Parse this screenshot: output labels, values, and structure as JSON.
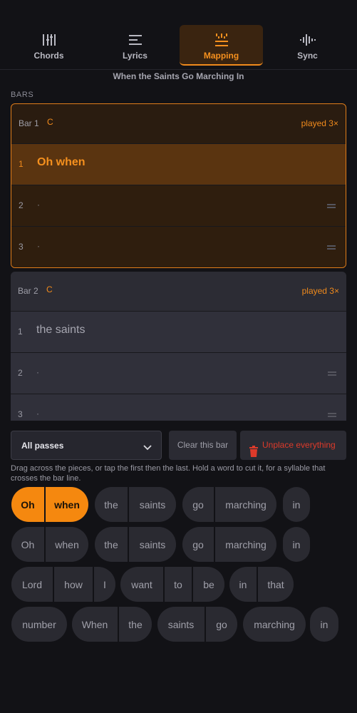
{
  "tabs": [
    {
      "label": "Chords",
      "icon": "chords-icon",
      "active": false
    },
    {
      "label": "Lyrics",
      "icon": "lyrics-icon",
      "active": false
    },
    {
      "label": "Mapping",
      "icon": "mapping-icon",
      "active": true
    },
    {
      "label": "Sync",
      "icon": "sync-icon",
      "active": false
    }
  ],
  "song_title": "When the Saints Go Marching In",
  "bars_label": "BARS",
  "bars": [
    {
      "name": "Bar 1",
      "chord": "C",
      "played": "played 3×",
      "rows": [
        {
          "num": "1",
          "text": "Oh when",
          "highlighted": true
        },
        {
          "num": "2",
          "text": "·",
          "highlighted": false
        },
        {
          "num": "3",
          "text": "·",
          "highlighted": false
        }
      ]
    },
    {
      "name": "Bar 2",
      "chord": "C",
      "played": "played 3×",
      "rows": [
        {
          "num": "1",
          "text": "the saints",
          "highlighted": false
        },
        {
          "num": "2",
          "text": "·",
          "highlighted": false
        },
        {
          "num": "3",
          "text": "·",
          "highlighted": false
        }
      ]
    }
  ],
  "controls": {
    "pass_select": "All passes",
    "clear_label": "Clear this bar",
    "unplace_label": "Unplace everything"
  },
  "help_text": "Drag across the pieces, or tap the first then the last. Hold a word to cut it, for a syllable that crosses the bar line.",
  "pieces": [
    [
      [
        "Oh",
        "when"
      ],
      [
        "the",
        "saints"
      ],
      [
        "go",
        "marching"
      ],
      [
        "in"
      ]
    ],
    [
      [
        "Oh",
        "when"
      ],
      [
        "the",
        "saints"
      ],
      [
        "go",
        "marching"
      ],
      [
        "in"
      ]
    ],
    [
      [
        "Lord",
        "how",
        "I"
      ],
      [
        "want",
        "to",
        "be"
      ],
      [
        "in",
        "that"
      ]
    ],
    [
      [
        "number"
      ],
      [
        "When",
        "the"
      ],
      [
        "saints",
        "go"
      ],
      [
        "marching"
      ],
      [
        "in"
      ]
    ]
  ],
  "colors": {
    "accent": "#f5880f",
    "danger": "#dd3a2a",
    "background": "#121216"
  }
}
